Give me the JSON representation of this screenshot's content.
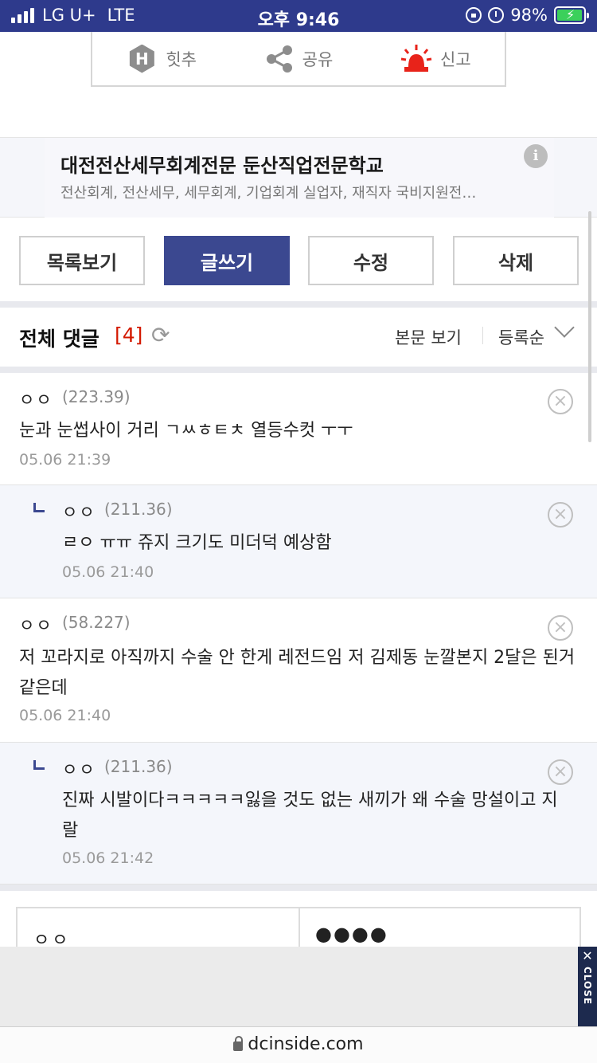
{
  "status": {
    "carrier": "LG U+",
    "network": "LTE",
    "time": "오후 9:46",
    "battery": "98%"
  },
  "actions": {
    "recommend": "힛추",
    "share": "공유",
    "report": "신고"
  },
  "ad": {
    "title": "대전전산세무회계전문 둔산직업전문학교",
    "desc": "전산회계, 전산세무, 세무회계, 기업회계 실업자, 재직자 국비지원전…",
    "info": "i"
  },
  "buttons": {
    "list": "목록보기",
    "write": "글쓰기",
    "edit": "수정",
    "delete": "삭제"
  },
  "comments_header": {
    "title": "전체 댓글",
    "count": "[4]",
    "view_post": "본문 보기",
    "sort": "등록순"
  },
  "comments": [
    {
      "nick": "ㅇㅇ",
      "ip": "(223.39)",
      "text": "눈과 눈썹사이 거리 ㄱㅆㅎㅌㅊ 열등수컷 ㅜㅜ",
      "date": "05.06 21:39"
    },
    {
      "nick": "ㅇㅇ",
      "ip": "(211.36)",
      "text": "ㄹㅇ ㅠㅠ 쥬지 크기도 미더덕 예상함",
      "date": "05.06 21:40"
    },
    {
      "nick": "ㅇㅇ",
      "ip": "(58.227)",
      "text": "저 꼬라지로 아직까지 수술 안 한게 레전드임 저 김제동 눈깔본지 2달은 된거 같은데",
      "date": "05.06 21:40"
    },
    {
      "nick": "ㅇㅇ",
      "ip": "(211.36)",
      "text": "진짜 시발이다ㅋㅋㅋㅋㅋ잃을 것도 없는 새끼가 왜 수술 망설이고 지랄",
      "date": "05.06 21:42"
    }
  ],
  "bottom_form": {
    "nick": "ㅇㅇ",
    "password": "●●●●"
  },
  "ad_close": {
    "x": "✕",
    "label": "CLOSE"
  },
  "url": "dcinside.com"
}
